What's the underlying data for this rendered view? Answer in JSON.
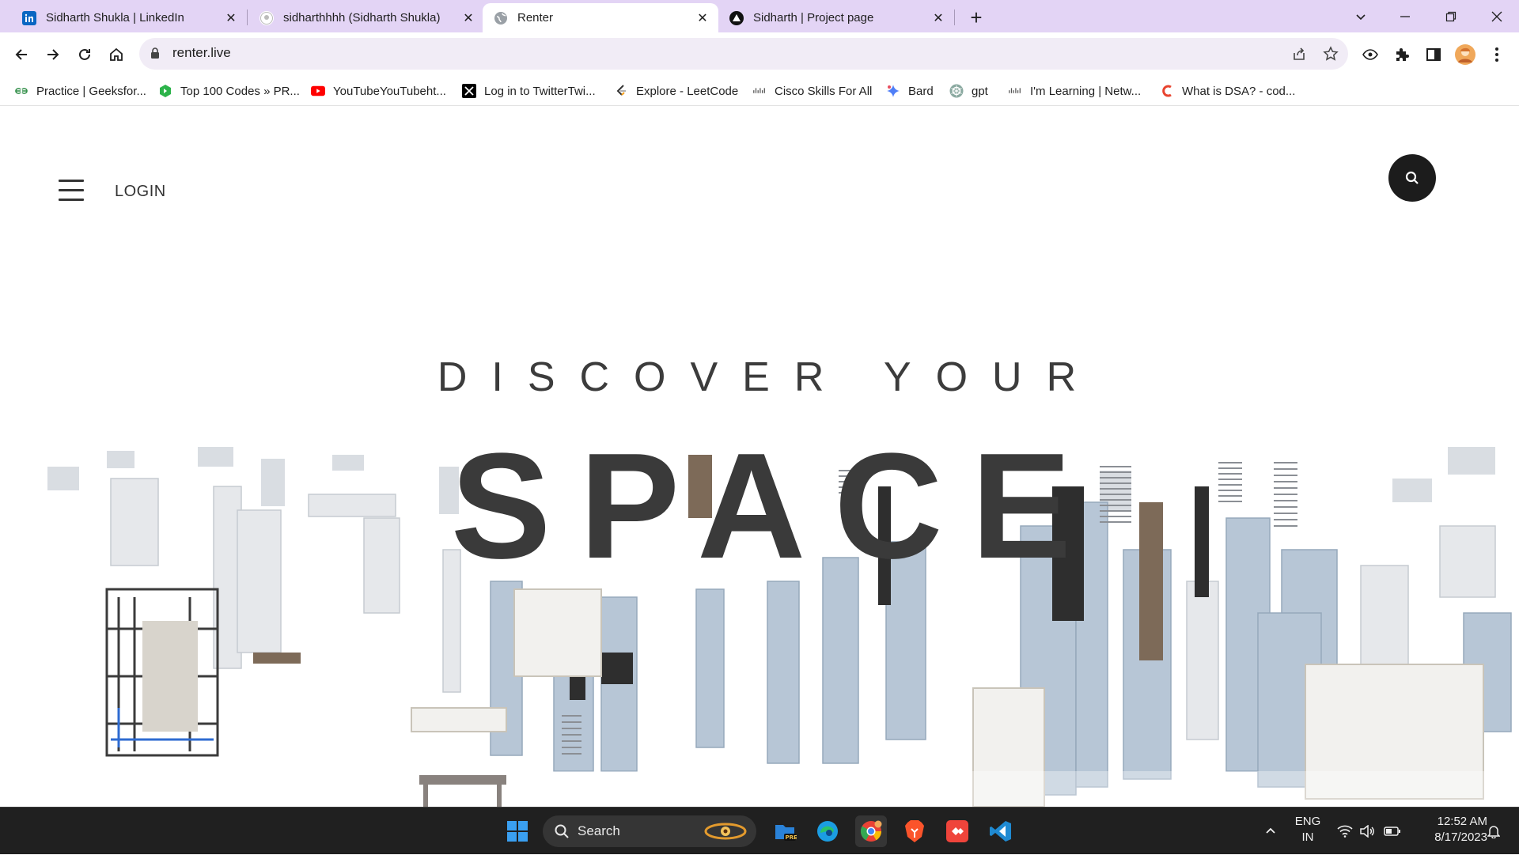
{
  "browser": {
    "tabs": [
      {
        "title": "Sidharth Shukla | LinkedIn",
        "icon": "linkedin-icon",
        "active": false
      },
      {
        "title": "sidharthhhh (Sidharth Shukla)",
        "icon": "github-icon",
        "active": false
      },
      {
        "title": "Renter",
        "icon": "globe-icon",
        "active": true
      },
      {
        "title": "Sidharth | Project page",
        "icon": "triangle-logo-icon",
        "active": false
      }
    ],
    "address": "renter.live",
    "bookmarks": [
      {
        "label": "Practice | Geeksfor...",
        "icon": "geeksforgeeks-icon"
      },
      {
        "label": "Top 100 Codes » PR...",
        "icon": "hexagon-icon"
      },
      {
        "label": "YouTubeYouTubeht...",
        "icon": "youtube-icon"
      },
      {
        "label": "Log in to TwitterTwi...",
        "icon": "x-icon"
      },
      {
        "label": "Explore - LeetCode",
        "icon": "leetcode-icon"
      },
      {
        "label": "Cisco Skills For All",
        "icon": "cisco-icon"
      },
      {
        "label": "Bard",
        "icon": "bard-icon"
      },
      {
        "label": "gpt",
        "icon": "openai-icon"
      },
      {
        "label": "I'm Learning | Netw...",
        "icon": "cisco-icon"
      },
      {
        "label": "What is DSA? - cod...",
        "icon": "codingninjas-icon"
      }
    ]
  },
  "page": {
    "login_label": "LOGIN",
    "headline_small": "DISCOVER YOUR",
    "headline_large": "SPACE"
  },
  "taskbar": {
    "search_label": "Search",
    "lang_line1": "ENG",
    "lang_line2": "IN",
    "time": "12:52 AM",
    "date": "8/17/2023"
  },
  "colors": {
    "tabstrip": "#e3d4f5",
    "omnibox": "#f1ecf6",
    "headline": "#3a3a3a",
    "taskbar": "#202020",
    "search_button": "#1c1c1c"
  }
}
